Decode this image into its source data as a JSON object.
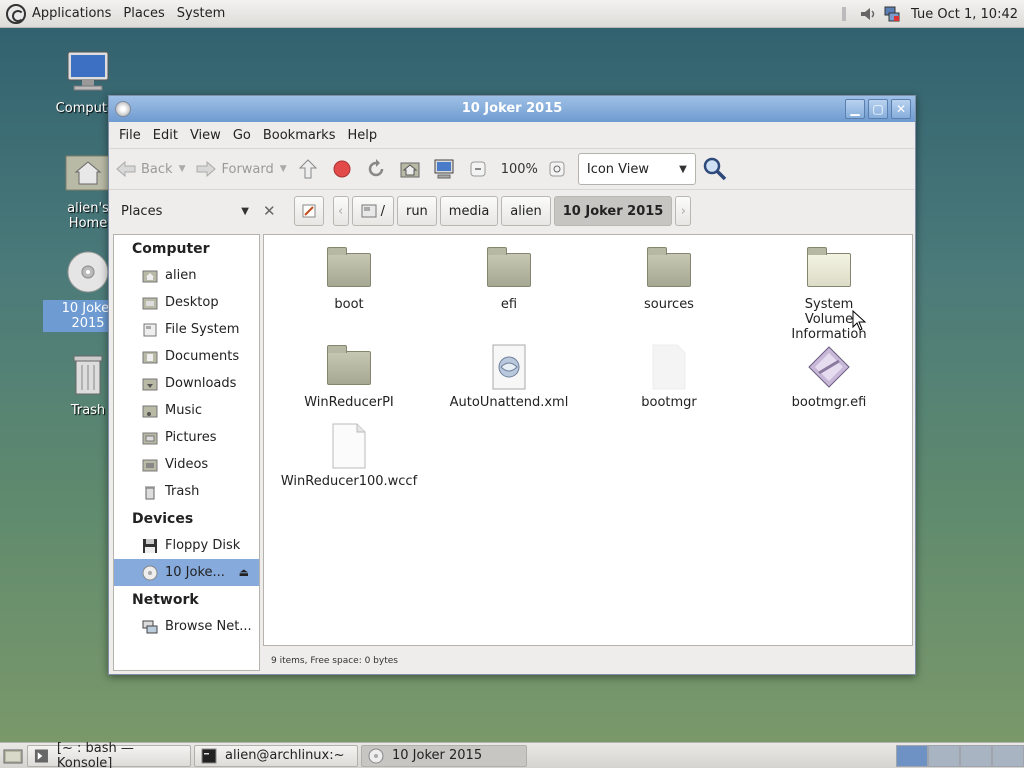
{
  "top_panel": {
    "menus": [
      "Applications",
      "Places",
      "System"
    ],
    "clock": "Tue Oct  1, 10:42"
  },
  "desktop_icons": [
    {
      "label": "Computer",
      "icon": "computer-icon"
    },
    {
      "label": "alien's Home",
      "icon": "home-folder-icon"
    },
    {
      "label": "10 Joker 2015",
      "icon": "cd-icon",
      "selected": true
    },
    {
      "label": "Trash",
      "icon": "trash-icon"
    }
  ],
  "window": {
    "title": "10 Joker 2015",
    "menubar": [
      "File",
      "Edit",
      "View",
      "Go",
      "Bookmarks",
      "Help"
    ],
    "toolbar": {
      "back": "Back",
      "forward": "Forward",
      "zoom": "100%",
      "view_mode": "Icon View"
    },
    "sidebar_combo": "Places",
    "breadcrumb": [
      "/",
      "run",
      "media",
      "alien",
      "10 Joker 2015"
    ],
    "sidebar": {
      "computer_header": "Computer",
      "computer_items": [
        "alien",
        "Desktop",
        "File System",
        "Documents",
        "Downloads",
        "Music",
        "Pictures",
        "Videos",
        "Trash"
      ],
      "devices_header": "Devices",
      "device_items": [
        "Floppy Disk",
        "10 Joke..."
      ],
      "network_header": "Network",
      "network_items": [
        "Browse Net..."
      ]
    },
    "files": [
      {
        "name": "boot",
        "type": "folder"
      },
      {
        "name": "efi",
        "type": "folder"
      },
      {
        "name": "sources",
        "type": "folder"
      },
      {
        "name": "System Volume Information",
        "type": "folder-light"
      },
      {
        "name": "WinReducerPI",
        "type": "folder"
      },
      {
        "name": "AutoUnattend.xml",
        "type": "xml"
      },
      {
        "name": "bootmgr",
        "type": "blank"
      },
      {
        "name": "bootmgr.efi",
        "type": "efi"
      },
      {
        "name": "WinReducer100.wccf",
        "type": "doc"
      }
    ],
    "status": "9 items, Free space: 0 bytes"
  },
  "taskbar": {
    "tasks": [
      "[~ : bash — Konsole]",
      "alien@archlinux:~",
      "10 Joker 2015"
    ]
  }
}
